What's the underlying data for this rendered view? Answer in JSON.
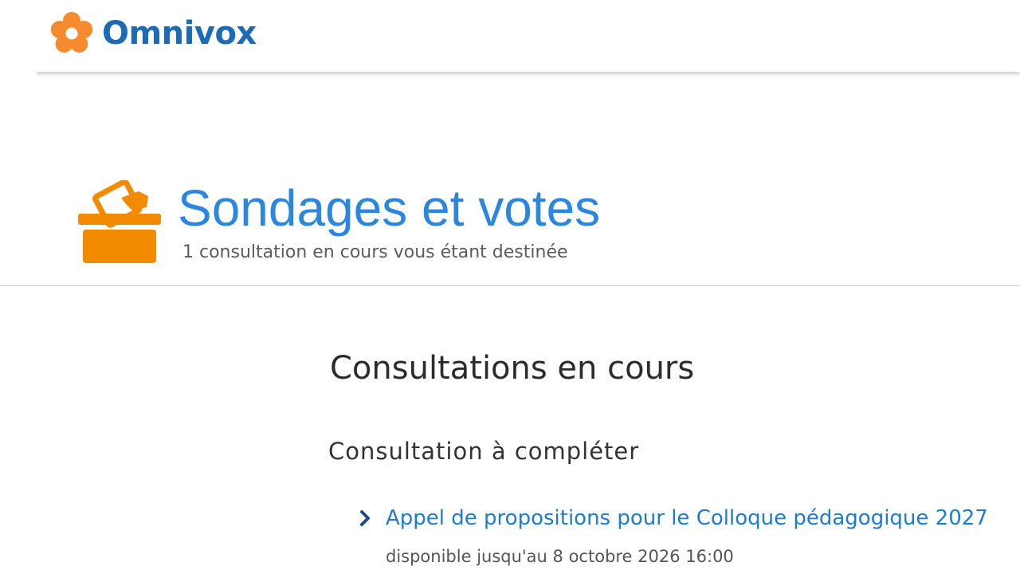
{
  "header": {
    "logo_text": "Omnivox",
    "logo_icon": "flower-icon",
    "brand_color": "#1b6cb5",
    "flower_color": "#f58a2e"
  },
  "hero": {
    "title": "Sondages et votes",
    "subtitle": "1 consultation en cours vous étant destinée",
    "icon": "ballot-box-icon",
    "title_color": "#2a86de",
    "icon_color": "#f28b00"
  },
  "main": {
    "section_title": "Consultations en cours",
    "subsection_title": "Consultation à compléter",
    "consultations": [
      {
        "title": "Appel de propositions pour le Colloque pédagogique 2027",
        "availability": "disponible jusqu'au 8 octobre 2026 16:00",
        "icon": "chevron-right-icon"
      }
    ]
  }
}
